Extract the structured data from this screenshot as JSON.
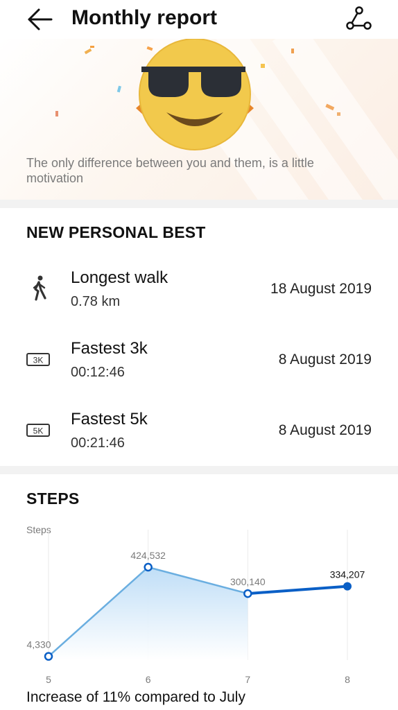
{
  "header": {
    "title": "Monthly report",
    "back_icon": "back-arrow-icon",
    "share_icon": "share-icon"
  },
  "banner": {
    "emoji_icon": "sunglasses-face-icon",
    "motto": "The only difference between you and them, is a little motivation"
  },
  "personal_best": {
    "title": "NEW PERSONAL BEST",
    "items": [
      {
        "icon": "walking-person-icon",
        "name": "Longest walk",
        "value": "0.78 km",
        "date": "18 August 2019"
      },
      {
        "icon": "3k-badge-icon",
        "badge": "3K",
        "name": "Fastest 3k",
        "value": "00:12:46",
        "date": "8 August 2019"
      },
      {
        "icon": "5k-badge-icon",
        "badge": "5K",
        "name": "Fastest 5k",
        "value": "00:21:46",
        "date": "8 August 2019"
      }
    ]
  },
  "steps": {
    "title": "STEPS",
    "footer": "Increase of 11% compared to July"
  },
  "chart_data": {
    "type": "line",
    "ylabel": "Steps",
    "categories": [
      "5",
      "6",
      "7",
      "8"
    ],
    "value_labels": [
      "4,330",
      "424,532",
      "300,140",
      "334,207"
    ],
    "series": [
      {
        "values": [
          4330,
          424532,
          300140,
          334207
        ]
      }
    ],
    "highlight_index": 3,
    "colors": {
      "line": "#6aaee0",
      "highlight": "#0a5fc6",
      "fill_top": "#bcdcf6"
    }
  }
}
